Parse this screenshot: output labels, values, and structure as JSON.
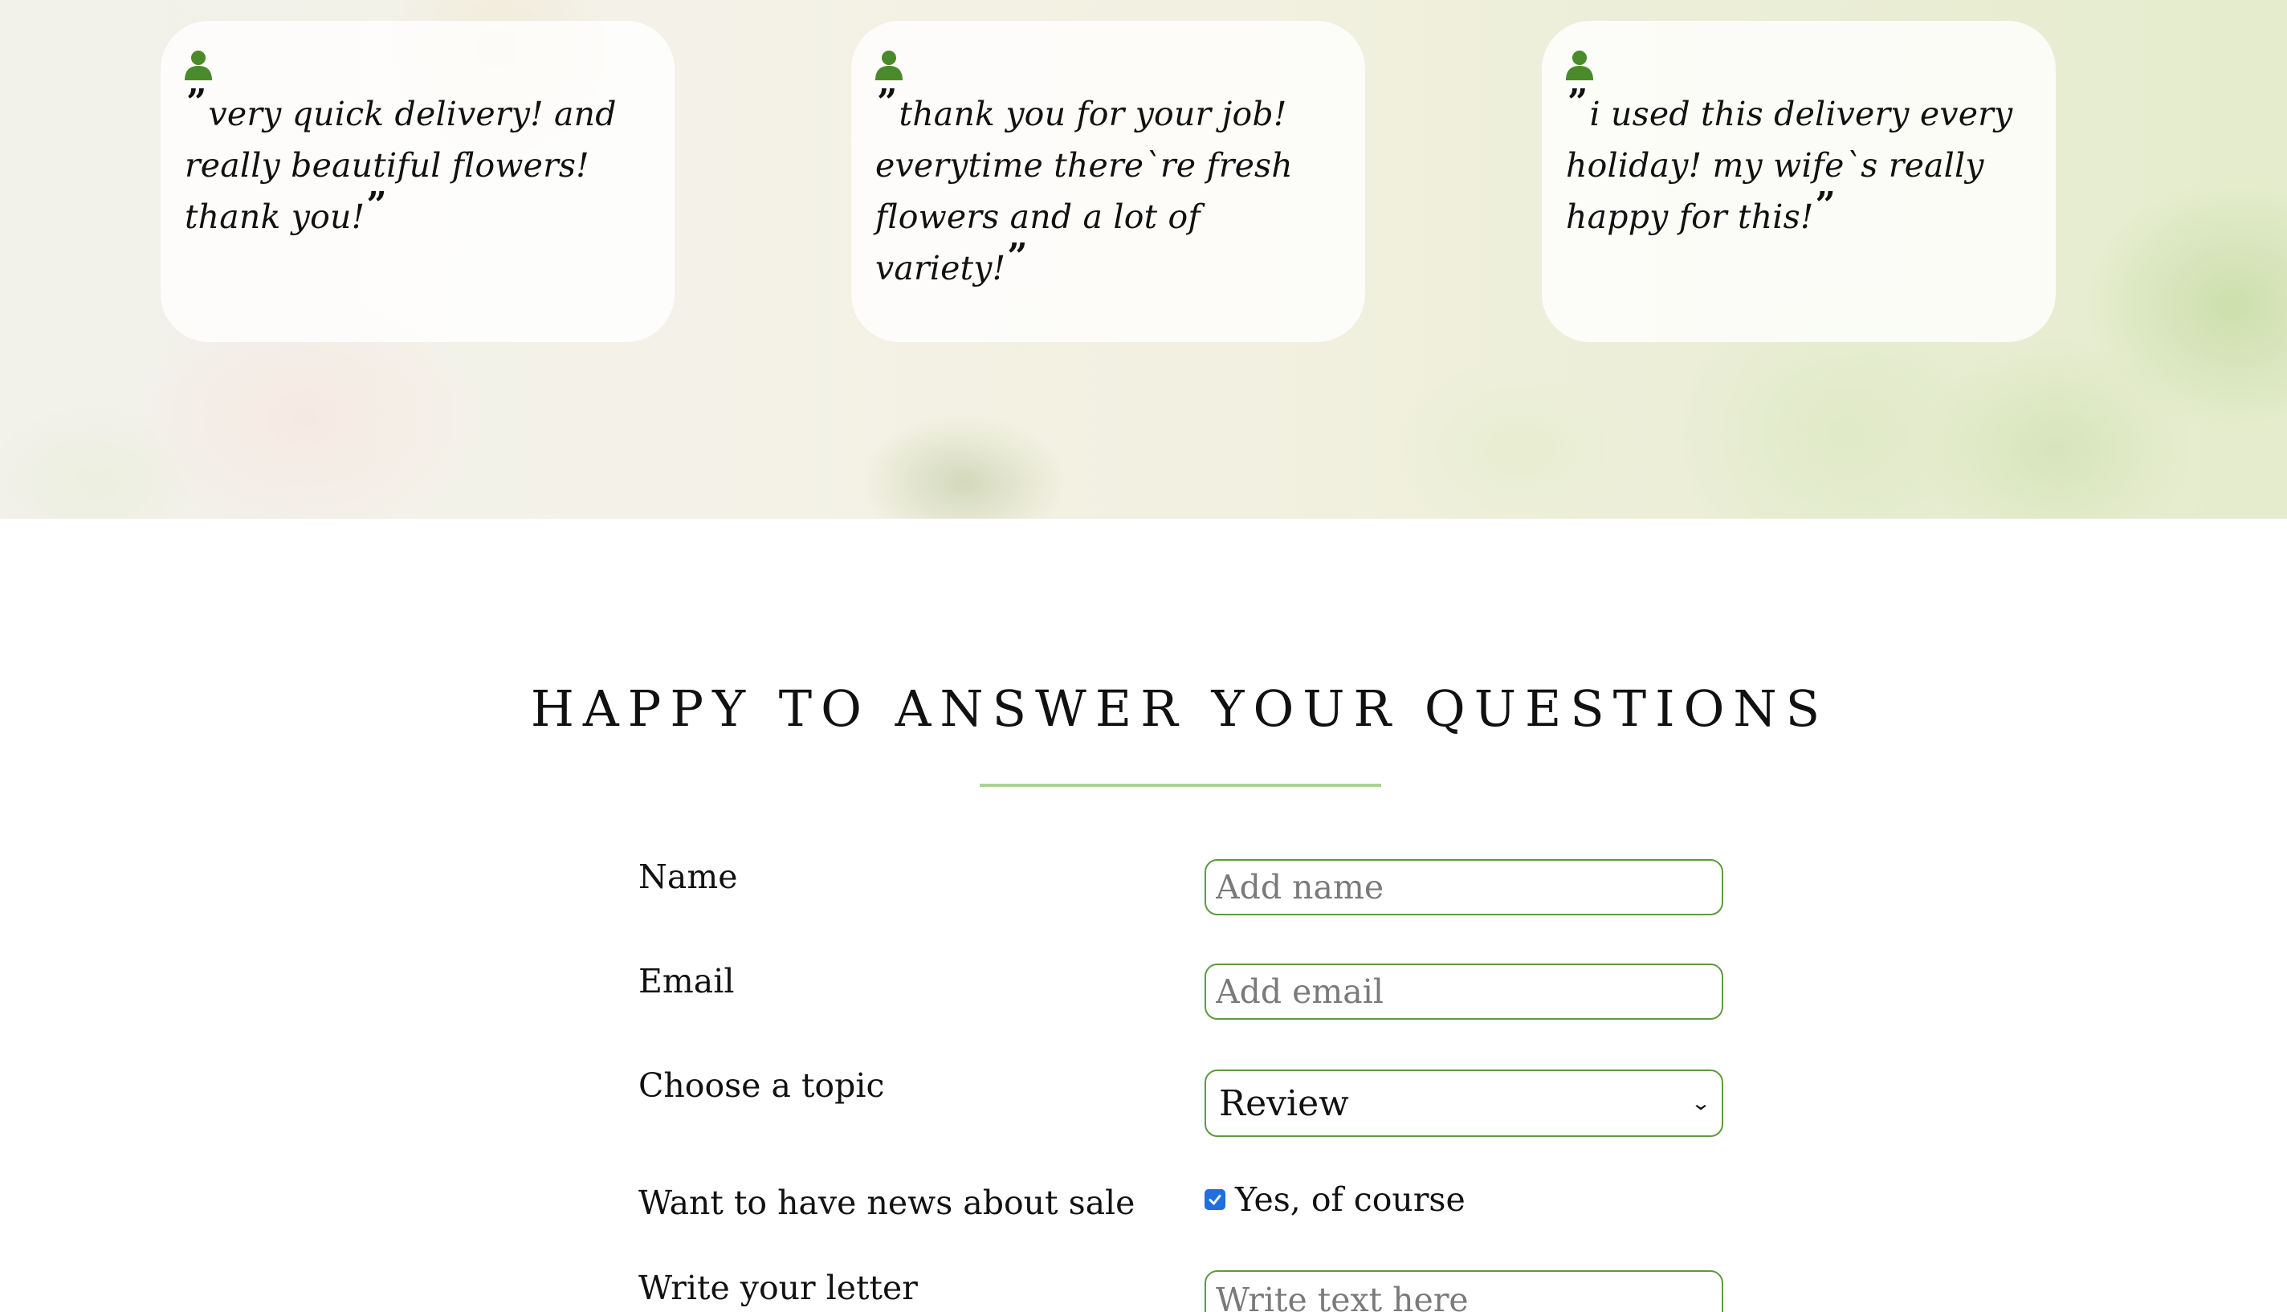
{
  "testimonials": [
    {
      "icon": "user-icon",
      "text": "very quick delivery! and really beautiful flowers! thank you!"
    },
    {
      "icon": "user-icon",
      "text": "thank you for your job! everytime there`re fresh flowers and a lot of variety!"
    },
    {
      "icon": "user-icon",
      "text": "i used this delivery every holiday! my wife`s really happy for this!"
    }
  ],
  "quote_open": "”",
  "quote_close": "”",
  "contact": {
    "title": "HAPPY TO ANSWER YOUR QUESTIONS",
    "name_label": "Name",
    "name_placeholder": "Add name",
    "email_label": "Email",
    "email_placeholder": "Add email",
    "topic_label": "Choose a topic",
    "topic_selected": "Review",
    "news_label": "Want to have news about sale",
    "news_checkbox_label": "Yes, of course",
    "news_checked": true,
    "letter_label": "Write your letter",
    "letter_placeholder": "Write text here"
  },
  "colors": {
    "accent_green": "#5e9a3e",
    "icon_green": "#4a8a2a",
    "rule_green": "#a9d38e",
    "checkbox_blue": "#1f6fe0"
  }
}
